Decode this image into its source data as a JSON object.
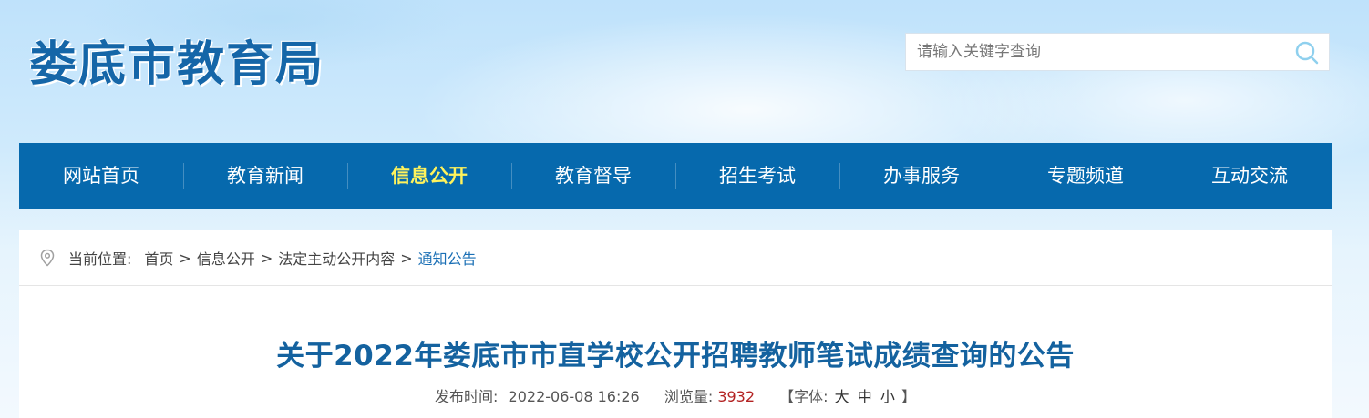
{
  "header": {
    "logo_text": "娄底市教育局",
    "search_placeholder": "请输入关键字查询",
    "search_icon": "search-icon"
  },
  "nav": {
    "items": [
      {
        "label": "网站首页"
      },
      {
        "label": "教育新闻"
      },
      {
        "label": "信息公开"
      },
      {
        "label": "教育督导"
      },
      {
        "label": "招生考试"
      },
      {
        "label": "办事服务"
      },
      {
        "label": "专题频道"
      },
      {
        "label": "互动交流"
      }
    ],
    "active_label": "信息公开",
    "bg_color": "#0669ad",
    "active_color": "#fff35c"
  },
  "breadcrumb": {
    "icon": "location-pin-icon",
    "prefix": "当前位置:",
    "items": [
      "首页",
      "信息公开",
      "法定主动公开内容",
      "通知公告"
    ],
    "separator": ">"
  },
  "article": {
    "title": "关于2022年娄底市市直学校公开招聘教师笔试成绩查询的公告",
    "publish_label": "发布时间:",
    "publish_time": "2022-06-08 16:26",
    "views_label": "浏览量:",
    "views": "3932",
    "font_open": "【字体:",
    "font_large": "大",
    "font_medium": "中",
    "font_small": "小",
    "font_close": "】",
    "title_color": "#14629f"
  }
}
